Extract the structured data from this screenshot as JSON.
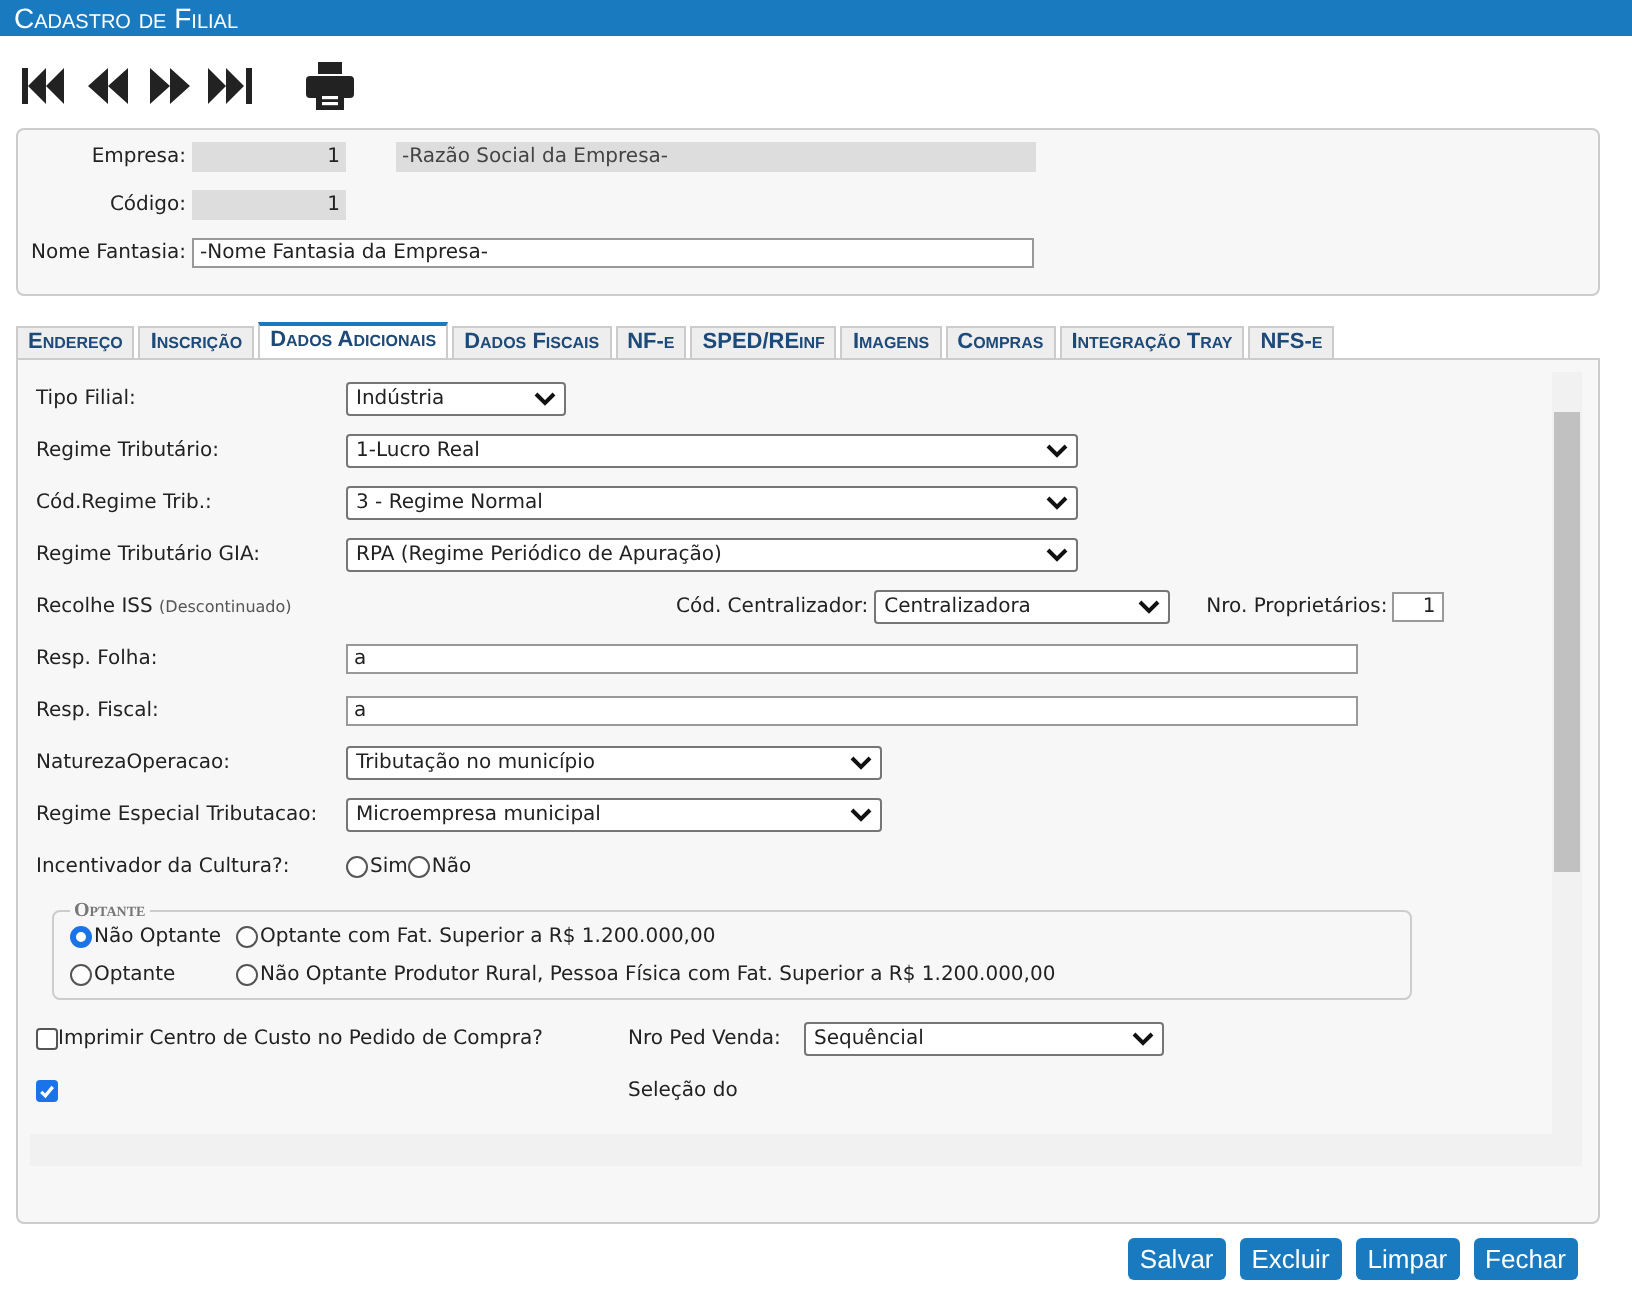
{
  "window": {
    "title": "Cadastro de Filial"
  },
  "header": {
    "empresa": {
      "label": "Empresa:",
      "code": "1",
      "name": "-Razão Social da Empresa-"
    },
    "codigo": {
      "label": "Código:",
      "value": "1"
    },
    "nome_fantasia": {
      "label": "Nome Fantasia:",
      "value": "-Nome Fantasia da Empresa-"
    }
  },
  "tabs": [
    {
      "label": "Endereço",
      "selected": false
    },
    {
      "label": "Inscrição",
      "selected": false
    },
    {
      "label": "Dados Adicionais",
      "selected": true
    },
    {
      "label": "Dados Fiscais",
      "selected": false
    },
    {
      "label": "NF-e",
      "selected": false
    },
    {
      "label": "SPED/REinf",
      "selected": false
    },
    {
      "label": "Imagens",
      "selected": false
    },
    {
      "label": "Compras",
      "selected": false
    },
    {
      "label": "Integração Tray",
      "selected": false
    },
    {
      "label": "NFS-e",
      "selected": false
    }
  ],
  "form": {
    "tipo_filial": {
      "label": "Tipo Filial:",
      "value": "Indústria"
    },
    "regime_tributario": {
      "label": "Regime Tributário:",
      "value": "1-Lucro Real"
    },
    "cod_regime_trib": {
      "label": "Cód.Regime Trib.:",
      "value": "3 - Regime Normal"
    },
    "regime_tributario_gia": {
      "label": "Regime Tributário GIA:",
      "value": "RPA (Regime Periódico de Apuração)"
    },
    "recolhe_iss": {
      "label": "Recolhe ISS",
      "note": "(Descontinuado)"
    },
    "cod_centralizador": {
      "label": "Cód. Centralizador:",
      "value": "Centralizadora"
    },
    "nro_proprietarios": {
      "label": "Nro. Proprietários:",
      "value": "1"
    },
    "resp_folha": {
      "label": "Resp. Folha:",
      "value": "a"
    },
    "resp_fiscal": {
      "label": "Resp. Fiscal:",
      "value": "a"
    },
    "natureza_operacao": {
      "label": "NaturezaOperacao:",
      "value": "Tributação no município"
    },
    "regime_especial": {
      "label": "Regime Especial Tributacao:",
      "value": "Microempresa municipal"
    },
    "incentivador_cultura": {
      "label": "Incentivador da Cultura?:",
      "options": [
        {
          "label": "Sim",
          "selected": false
        },
        {
          "label": "Não",
          "selected": false
        }
      ]
    },
    "optante": {
      "legend": "Optante",
      "options": [
        {
          "label": "Não Optante",
          "selected": true
        },
        {
          "label": "Optante com Fat. Superior a R$ 1.200.000,00",
          "selected": false
        },
        {
          "label": "Optante",
          "selected": false
        },
        {
          "label": "Não Optante Produtor Rural, Pessoa Física com Fat. Superior a R$ 1.200.000,00",
          "selected": false
        }
      ]
    },
    "imprimir_centro_custo": {
      "label": "Imprimir Centro de Custo no Pedido de Compra?",
      "checked": false
    },
    "nro_ped_venda": {
      "label": "Nro Ped Venda:",
      "value": "Sequêncial"
    },
    "permitir_alteracao": {
      "checked": true
    },
    "selecao_do": {
      "label": "Seleção do"
    }
  },
  "buttons": [
    "Salvar",
    "Excluir",
    "Limpar",
    "Fechar"
  ]
}
